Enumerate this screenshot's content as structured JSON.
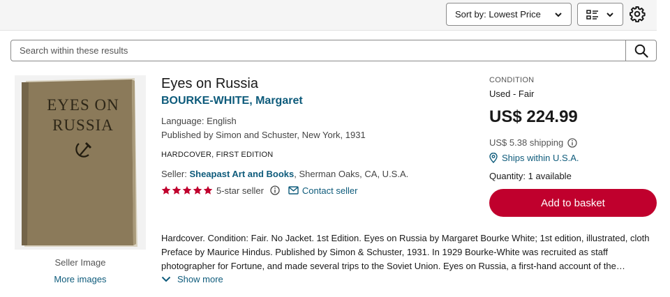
{
  "toolbar": {
    "sort_label": "Sort by: Lowest Price",
    "view_icon": "list-view-icon",
    "settings_icon": "gear-icon"
  },
  "search": {
    "placeholder": "Search within these results",
    "value": ""
  },
  "listing": {
    "cover": {
      "line1": "EYES ON",
      "line2": "RUSSIA",
      "color": "#8b7a5a"
    },
    "image_caption": "Seller Image",
    "more_images": "More images",
    "title": "Eyes on Russia",
    "author": "BOURKE-WHITE, Margaret",
    "language": "Language: English",
    "published": "Published by Simon and Schuster, New York, 1931",
    "binding": "HARDCOVER, FIRST EDITION",
    "seller_prefix": "Seller: ",
    "seller_name": "Sheapast Art and Books",
    "seller_location": ", Sherman Oaks, CA, U.S.A.",
    "rating_stars": 5,
    "rating_label": "5-star seller",
    "contact_label": "Contact seller",
    "description": "Hardcover. Condition: Fair. No Jacket. 1st Edition. Eyes on Russia by Margaret Bourke White; 1st edition, illustrated, cloth Preface by Maurice Hindus. Published by Simon & Schuster, 1931. In 1929 Bourke-White was recruited as staff photographer for Fortune, and made several trips to the Soviet Union. Eyes on Russia, a first-hand account of the photographer's experiences.",
    "show_more": "Show more",
    "condition_label": "CONDITION",
    "condition_value": "Used - Fair",
    "price": "US$ 224.99",
    "shipping": "US$ 5.38 shipping",
    "ships_within": "Ships within U.S.A.",
    "quantity": "Quantity: 1 available",
    "basket_label": "Add to basket"
  },
  "colors": {
    "link": "#0e5b7b",
    "accent_button": "#c0002d",
    "star": "#c0002d"
  }
}
